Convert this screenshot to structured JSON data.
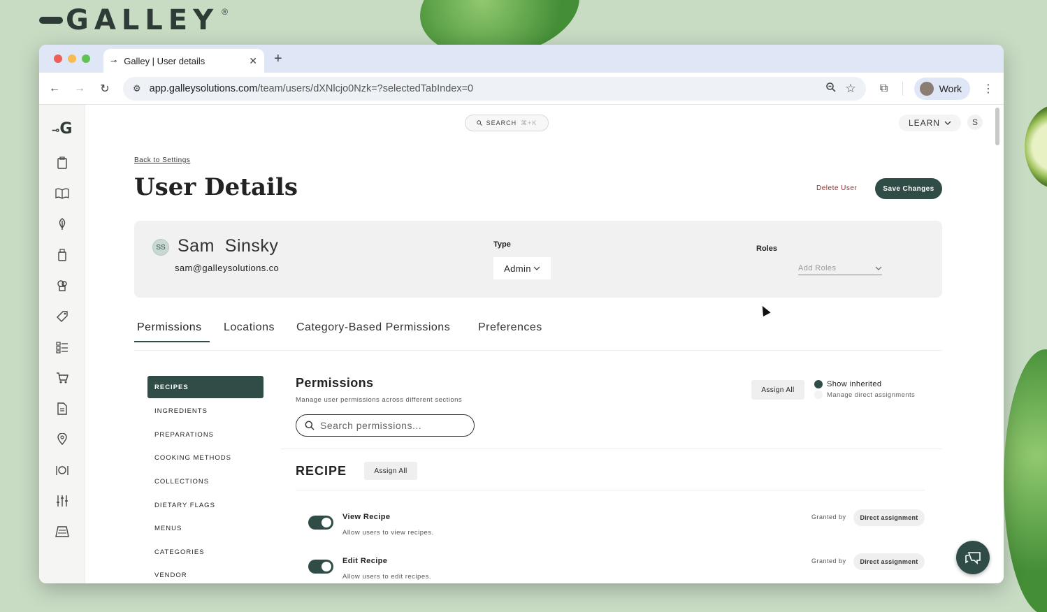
{
  "brand": {
    "name": "GALLEY",
    "reg": "®"
  },
  "browser": {
    "tab_title": "Galley | User details",
    "url_domain": "app.galleysolutions.com",
    "url_path": "/team/users/dXNlcjo0Nzk=?selectedTabIndex=0",
    "profile_label": "Work",
    "colors": {
      "close": "#ee5f57",
      "minimize": "#f5bd4f",
      "maximize": "#5fc454"
    }
  },
  "topbar": {
    "search_label": "SEARCH",
    "search_kbd": "⌘+K",
    "learn_label": "LEARN",
    "avatar_initial": "S"
  },
  "rail": {
    "logo": "G",
    "icons": [
      "clipboard-icon",
      "book-icon",
      "leaf-icon",
      "jar-icon",
      "chef-icon",
      "tag-icon",
      "checklist-icon",
      "cart-icon",
      "document-icon",
      "location-pin-icon",
      "dining-icon",
      "sliders-icon",
      "menu-board-icon"
    ]
  },
  "page": {
    "back_link": "Back to Settings",
    "title": "User Details",
    "delete_label": "Delete User",
    "save_label": "Save Changes"
  },
  "user": {
    "initials": "SS",
    "name": "Sam  Sinsky",
    "email": "sam@galleysolutions.co",
    "type_label": "Type",
    "type_value": "Admin",
    "roles_label": "Roles",
    "roles_placeholder": "Add Roles"
  },
  "tabs": [
    {
      "label": "Permissions",
      "active": true
    },
    {
      "label": "Locations",
      "active": false
    },
    {
      "label": "Category-Based Permissions",
      "active": false
    },
    {
      "label": "Preferences",
      "active": false
    }
  ],
  "side_menu": [
    "RECIPES",
    "INGREDIENTS",
    "PREPARATIONS",
    "COOKING METHODS",
    "COLLECTIONS",
    "DIETARY FLAGS",
    "MENUS",
    "CATEGORIES",
    "VENDOR"
  ],
  "permissions": {
    "title": "Permissions",
    "subtitle": "Manage user permissions across different sections",
    "search_placeholder": "Search permissions...",
    "assign_all_label": "Assign All",
    "show_inherited_label": "Show inherited",
    "manage_direct_label": "Manage direct assignments",
    "section_title": "RECIPE",
    "section_assign_all": "Assign All",
    "items": [
      {
        "name": "View Recipe",
        "desc": "Allow users to view recipes.",
        "granted_label": "Granted by",
        "badge": "Direct assignment",
        "enabled": true
      },
      {
        "name": "Edit Recipe",
        "desc": "Allow users to edit recipes.",
        "granted_label": "Granted by",
        "badge": "Direct assignment",
        "enabled": true
      }
    ]
  },
  "accent_color": "#2f4d46"
}
